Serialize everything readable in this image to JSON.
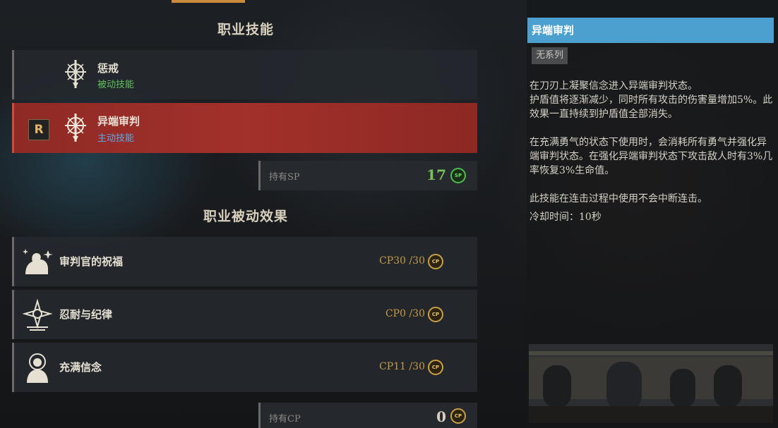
{
  "sections": {
    "class_skills_title": "职业技能",
    "class_passive_title": "职业被动效果"
  },
  "skills": [
    {
      "name": "惩戒",
      "type": "被动技能",
      "icon": "spear-emblem-icon"
    },
    {
      "name": "异端审判",
      "type": "主动技能",
      "icon": "spear-emblem-icon",
      "key": "R",
      "selected": true
    }
  ],
  "sp": {
    "label": "持有SP",
    "value": "17",
    "coin": "SP"
  },
  "passives": [
    {
      "name": "审判官的祝福",
      "cp": "CP30 /30",
      "icon": "flexed-arm-icon"
    },
    {
      "name": "忍耐与纪律",
      "cp": "CP0 /30",
      "icon": "holy-cross-emblem-icon"
    },
    {
      "name": "充满信念",
      "cp": "CP11 /30",
      "icon": "praying-figure-icon"
    }
  ],
  "cp": {
    "label": "持有CP",
    "value": "0",
    "coin": "CP"
  },
  "detail": {
    "title": "异端审判",
    "tag": "无系列",
    "lines": [
      "在刀刃上凝聚信念进入异端审判状态。",
      "护盾值将逐渐减少，同时所有攻击的伤害量增加5%。此效果一直持续到护盾值全部消失。",
      "在充满勇气的状态下使用时，会消耗所有勇气并强化异端审判状态。在强化异端审判状态下攻击敌人时有3%几率恢复3%生命值。",
      "此技能在连击过程中使用不会中断连击。",
      "冷却时间：10秒"
    ]
  },
  "colors": {
    "selected_row": "#a3302a",
    "title_bar": "#4ba0d0",
    "sp_value": "#78c25a",
    "cp_text": "#c79a45"
  }
}
